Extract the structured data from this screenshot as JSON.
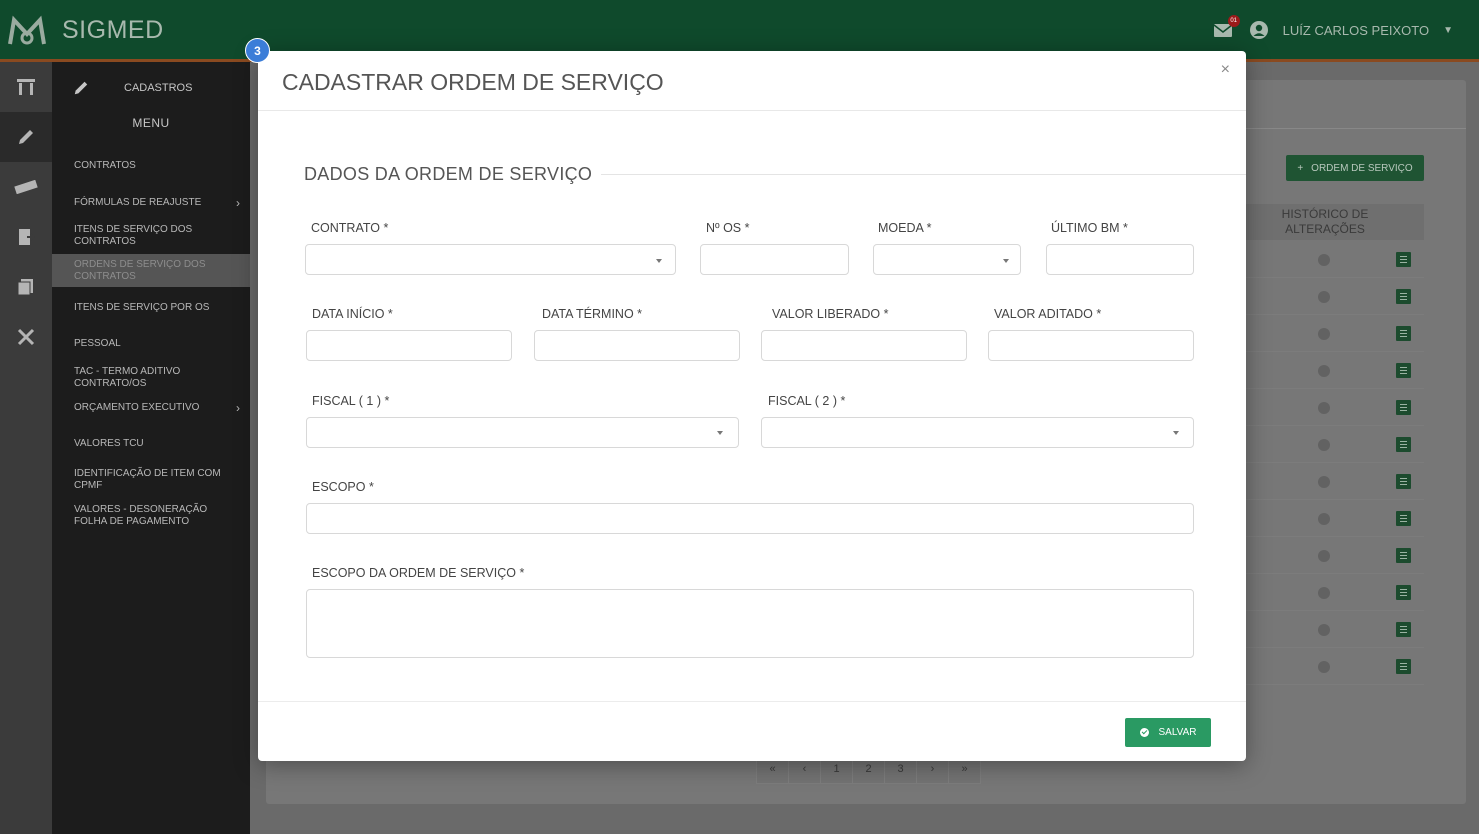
{
  "app": {
    "brand": "SIGMED",
    "mail_count": "01",
    "user_name": "LUÍZ CARLOS PEIXOTO"
  },
  "menu": {
    "header": "CADASTROS",
    "title": "MENU",
    "items": [
      {
        "label": "CONTRATOS"
      },
      {
        "label": "FÓRMULAS DE REAJUSTE"
      },
      {
        "label": "ITENS DE SERVIÇO DOS CONTRATOS"
      },
      {
        "label": "ORDENS DE SERVIÇO DOS CONTRATOS"
      },
      {
        "label": "ITENS DE SERVIÇO POR OS"
      },
      {
        "label": "PESSOAL"
      },
      {
        "label": "TAC - TERMO ADITIVO CONTRATO/OS"
      },
      {
        "label": "ORÇAMENTO EXECUTIVO"
      },
      {
        "label": "VALORES TCU"
      },
      {
        "label": "IDENTIFICAÇÃO DE ITEM COM CPMF"
      },
      {
        "label": "VALORES - DESONERAÇÃO FOLHA DE PAGAMENTO"
      }
    ]
  },
  "background": {
    "add_button": "ORDEM DE SERVIÇO",
    "history_header_line1": "HISTÓRICO DE",
    "history_header_line2": "ALTERAÇÕES",
    "pager": [
      "«",
      "‹",
      "1",
      "2",
      "3",
      "›",
      "»"
    ]
  },
  "modal": {
    "step_badge": "3",
    "title": "CADASTRAR ORDEM DE SERVIÇO",
    "close": "×",
    "section": "DADOS DA ORDEM DE SERVIÇO",
    "labels": {
      "contrato": "CONTRATO *",
      "num_os": "Nº OS *",
      "moeda": "MOEDA *",
      "ultimo_bm": "ÚLTIMO BM *",
      "data_inicio": "DATA INÍCIO *",
      "data_termino": "DATA TÉRMINO *",
      "valor_liberado": "VALOR LIBERADO *",
      "valor_aditado": "VALOR ADITADO *",
      "fiscal1": "FISCAL ( 1 ) *",
      "fiscal2": "FISCAL ( 2 ) *",
      "escopo": "ESCOPO *",
      "escopo_os": "ESCOPO DA ORDEM DE SERVIÇO *"
    },
    "save": "SALVAR"
  },
  "colors": {
    "header": "#0f4a2c",
    "accent": "#2a9a63",
    "badge": "#3b7dd8"
  }
}
